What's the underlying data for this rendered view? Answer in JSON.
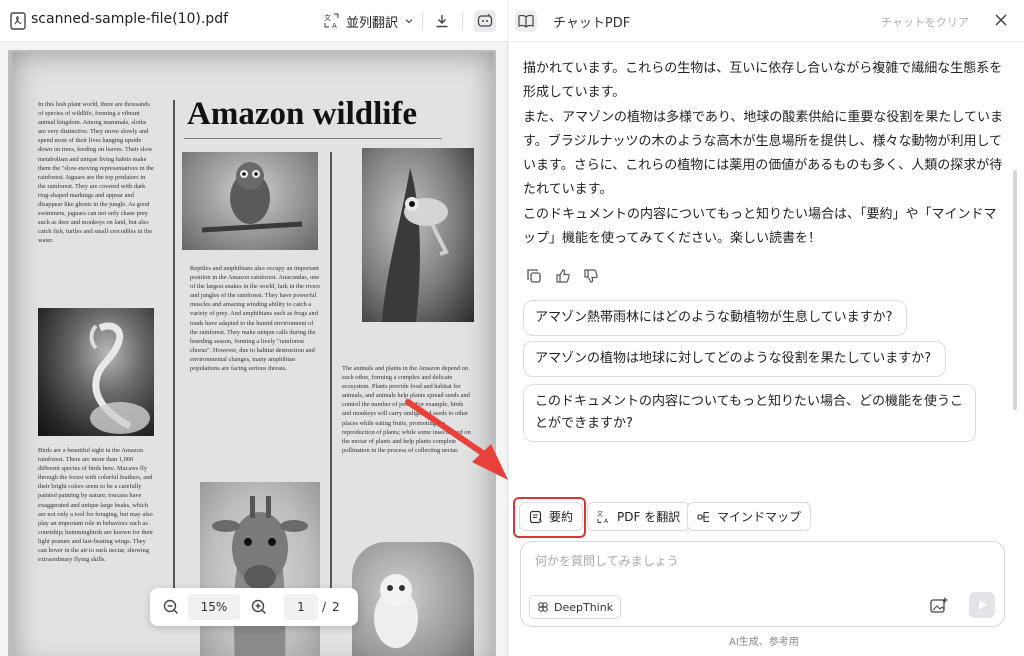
{
  "toolbar": {
    "file_name": "scanned-sample-file(10).pdf",
    "translate_label": "並列翻訳",
    "icons": [
      "pdf-file-icon",
      "translate-icon",
      "chevron-down-icon",
      "download-icon",
      "ai-chat-icon"
    ]
  },
  "document": {
    "title": "Amazon wildlife",
    "col1_top": "In this lush plant world, there are thousands of species of wildlife, forming a vibrant animal kingdom. Among mammals, sloths are very distinctive. They move slowly and spend most of their lives hanging upside down on trees, feeding on leaves. Their slow metabolism and unique living habits make them the \"slow-moving representatives in the rainforest. Jaguars are the top predators in the rainforest. They are covered with dark ring-shaped markings and appear and disappear like ghosts in the jungle. As good swimmers, jaguars can not only chase prey such as deer and monkeys on land, but also catch fish, turtles and small crocodiles in the water.",
    "col1_bottom": "Birds are a beautiful sight in the Amazon rainforest. There are more than 1,000 different species of birds here. Macaws fly through the forest with colorful feathers, and their bright colors seem to be a carefully painted painting by nature; toucans have exaggerated and unique large beaks, which are not only a tool for foraging, but may also play an important role in behaviors such as courtship; hummingbirds are known for their light posture and fast-beating wings. They can hover in the air to suck nectar, showing extraordinary flying skills.",
    "col2_text": "Reptiles and amphibians also occupy an important position in the Amazon rainforest. Anacondas, one of the largest snakes in the world, lurk in the rivers and jungles of the rainforest. They have powerful muscles and amazing winding ability to catch a variety of prey. And amphibians such as frogs and toads have adapted to the humid environment of the rainforest. They make unique calls during the breeding season, forming a lively \"rainforest chorus\". However, due to habitat destruction and environmental changes, many amphibian populations are facing serious threats.",
    "col3_text": "The animals and plants in the Amazon depend on each other, forming a complex and delicate ecosystem. Plants provide food and habitat for animals, and animals help plants spread seeds and control the number of pests. For example, birds and monkeys will carry undigested seeds to other places while eating fruits, promoting the reproduction of plants; while some insects feed on the nectar of plants and help plants complete pollination in the process of collecting nectar."
  },
  "zoom": {
    "value": "15%",
    "current_page": "1",
    "separator": "/",
    "total_pages": "2"
  },
  "chat": {
    "title": "チャットPDF",
    "clear_label": "チャットをクリア",
    "messages": [
      "描かれています。これらの生物は、互いに依存し合いながら複雑で繊細な生態系を形成しています。",
      "また、アマゾンの植物は多様であり、地球の酸素供給に重要な役割を果たしています。ブラジルナッツの木のような高木が生息場所を提供し、様々な動物が利用しています。さらに、これらの植物には薬用の価値があるものも多く、人類の探求が待たれています。",
      "このドキュメントの内容についてもっと知りたい場合は、「要約」や「マインドマップ」機能を使ってみてください。楽しい読書を！"
    ],
    "suggestions": [
      "アマゾン熱帯雨林にはどのような動植物が生息していますか?",
      "アマゾンの植物は地球に対してどのような役割を果たしていますか?",
      "このドキュメントの内容についてもっと知りたい場合、どの機能を使うことができますか?"
    ],
    "actions": {
      "summary": "要約",
      "translate_pdf": "PDF を翻訳",
      "mindmap": "マインドマップ"
    },
    "input_placeholder": "何かを質問してみましょう",
    "deepthink_label": "DeepThink",
    "footnote": "AI生成、参考用"
  },
  "colors": {
    "highlight": "#d23a3a",
    "arrow": "#e8403a"
  }
}
